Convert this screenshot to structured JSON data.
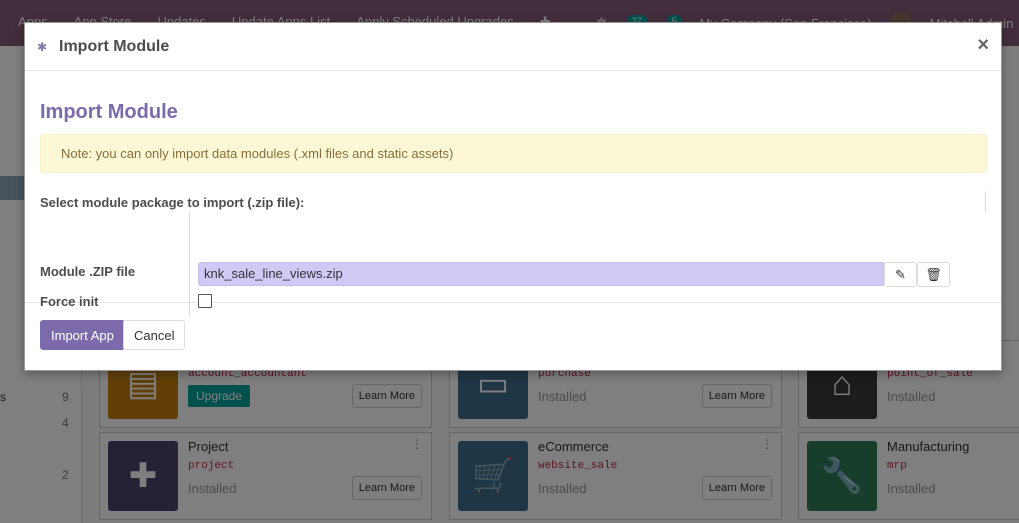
{
  "topbar": {
    "menu": [
      "Apps",
      "App Store",
      "Updates",
      "Update Apps List",
      "Apply Scheduled Upgrades"
    ],
    "activity_count": "27",
    "message_count": "5",
    "company": "My Company (San Francisco)",
    "user": "Mitchell Admin"
  },
  "sidebar": {
    "labels": [
      {
        "text": "s"
      }
    ],
    "counts": [
      "9",
      "4",
      "2"
    ]
  },
  "apps": [
    {
      "name": "",
      "tech": "account_accountant",
      "status": "",
      "action": "Upgrade",
      "learn": "Learn More",
      "icon": "document",
      "color": "#c47f0e"
    },
    {
      "name": "",
      "tech": "purchase",
      "status": "Installed",
      "action": "",
      "learn": "Learn More",
      "icon": "card",
      "color": "#3d6d8b"
    },
    {
      "name": "",
      "tech": "point_of_sale",
      "status": "Installed",
      "action": "",
      "learn": "",
      "icon": "store",
      "color": "#3a3a3a"
    },
    {
      "name": "Project",
      "tech": "project",
      "status": "Installed",
      "action": "",
      "learn": "Learn More",
      "icon": "puzzle",
      "color": "#4a4470"
    },
    {
      "name": "eCommerce",
      "tech": "website_sale",
      "status": "Installed",
      "action": "",
      "learn": "Learn More",
      "icon": "cart",
      "color": "#3d6d8b"
    },
    {
      "name": "Manufacturing",
      "tech": "mrp",
      "status": "Installed",
      "action": "",
      "learn": "",
      "icon": "wrench",
      "color": "#2f7d57"
    }
  ],
  "modal": {
    "title": "Import Module",
    "heading": "Import Module",
    "note": "Note: you can only import data modules (.xml files and static assets)",
    "section_label": "Select module package to import (.zip file):",
    "file_label": "Module .ZIP file",
    "file_value": "knk_sale_line_views.zip",
    "force_init_label": "Force init",
    "force_init_checked": false,
    "close_symbol": "×",
    "import_button": "Import App",
    "cancel_button": "Cancel"
  }
}
